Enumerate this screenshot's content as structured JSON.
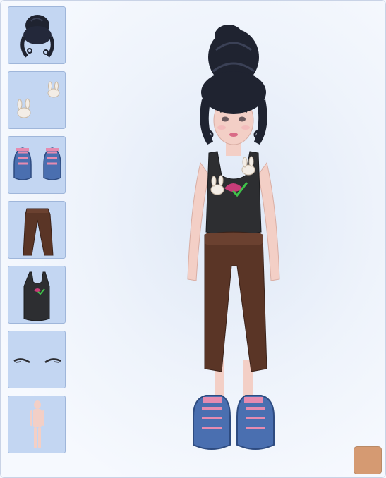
{
  "sidebar": {
    "items": [
      {
        "category": "hair",
        "icon": "hair-bun-icon"
      },
      {
        "category": "accessory",
        "icon": "bunny-clips-icon"
      },
      {
        "category": "shoes",
        "icon": "sneakers-icon"
      },
      {
        "category": "pants",
        "icon": "brown-pants-icon"
      },
      {
        "category": "top",
        "icon": "tank-top-icon"
      },
      {
        "category": "eyebrows",
        "icon": "eyebrows-icon"
      },
      {
        "category": "body",
        "icon": "base-body-icon"
      }
    ]
  },
  "colors": {
    "skin_swatch": "#d59a72",
    "slot_background": "#c3d6f2",
    "hair": "#1f2330",
    "pants": "#5a3526",
    "top": "#2d2e31",
    "shoes": "#4a6fb0",
    "shoe_accent": "#e58bb0",
    "skin": "#f3cfc6"
  }
}
